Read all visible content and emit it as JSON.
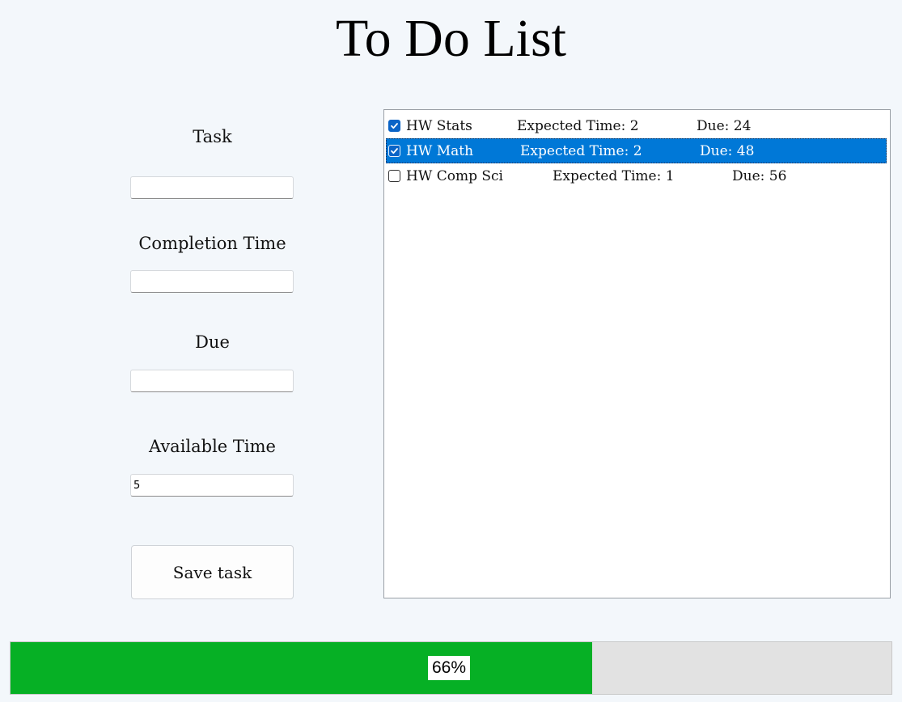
{
  "title": "To Do List",
  "form": {
    "task_label": "Task",
    "task_value": "",
    "completion_label": "Completion Time",
    "completion_value": "",
    "due_label": "Due",
    "due_value": "",
    "available_label": "Available Time",
    "available_value": "5",
    "save_label": "Save task"
  },
  "tasks": [
    {
      "name": "HW Stats",
      "expected": "Expected Time: 2",
      "due": "Due: 24",
      "checked": true,
      "selected": false
    },
    {
      "name": "HW Math",
      "expected": "Expected Time: 2",
      "due": "Due: 48",
      "checked": true,
      "selected": true
    },
    {
      "name": "HW Comp Sci",
      "expected": "Expected Time: 1",
      "due": "Due: 56",
      "checked": false,
      "selected": false
    }
  ],
  "progress": {
    "value": 0.66,
    "label": "66%"
  },
  "colors": {
    "background": "#f3f7fb",
    "selection": "#0078d7",
    "checkbox": "#0a64c7",
    "progress_fill": "#06b025",
    "progress_track": "#e2e2e2"
  }
}
